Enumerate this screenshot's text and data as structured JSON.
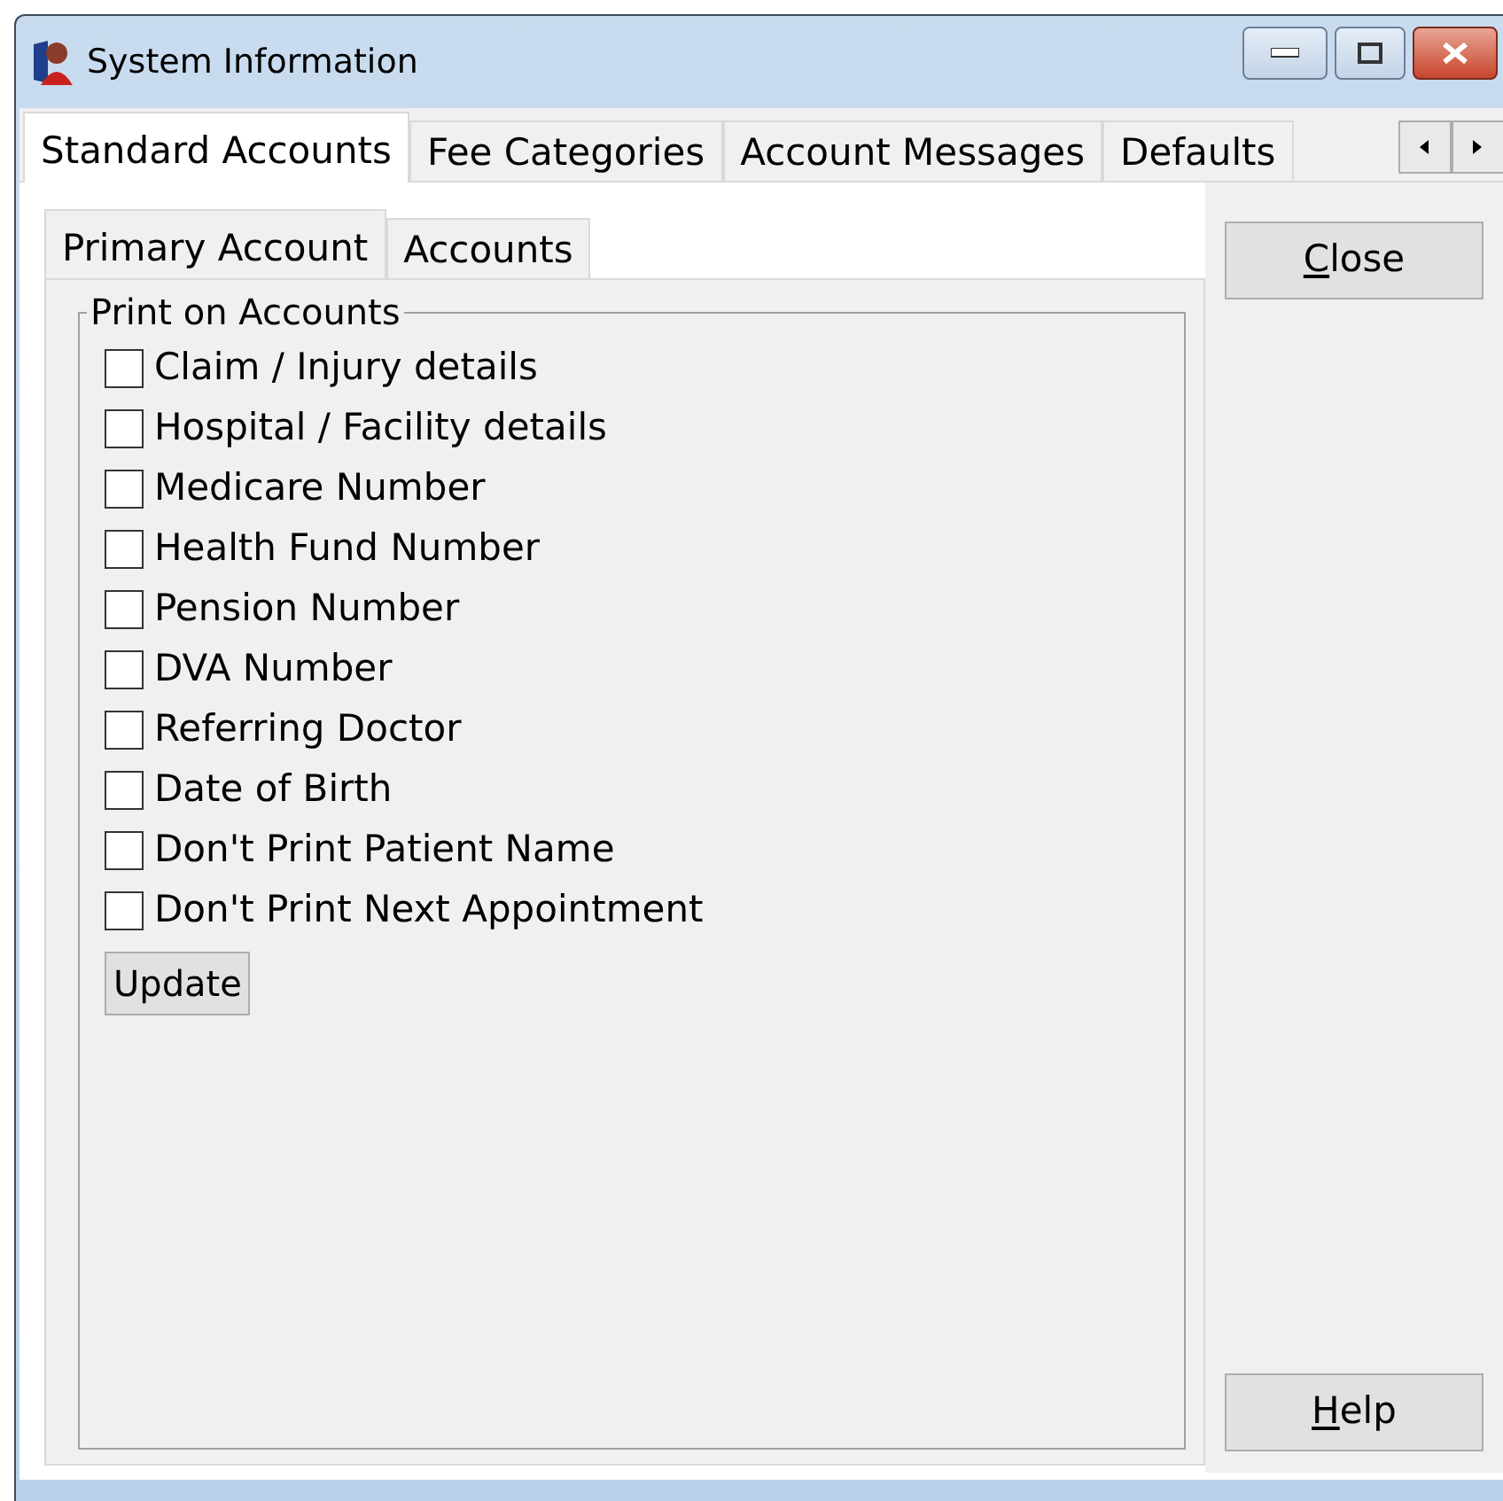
{
  "window": {
    "title": "System Information"
  },
  "tabs": [
    {
      "label": "Standard Accounts",
      "selected": true
    },
    {
      "label": "Fee Categories",
      "selected": false
    },
    {
      "label": "Account Messages",
      "selected": false
    },
    {
      "label": "Defaults",
      "selected": false
    }
  ],
  "sub_tabs": [
    {
      "label": "Primary Account",
      "selected": true
    },
    {
      "label": "Accounts",
      "selected": false
    }
  ],
  "group": {
    "title": "Print on Accounts",
    "options": [
      {
        "label": "Claim / Injury details",
        "checked": false
      },
      {
        "label": "Hospital / Facility details",
        "checked": false
      },
      {
        "label": "Medicare Number",
        "checked": false
      },
      {
        "label": "Health Fund Number",
        "checked": false
      },
      {
        "label": "Pension Number",
        "checked": false
      },
      {
        "label": "DVA Number",
        "checked": false
      },
      {
        "label": "Referring Doctor",
        "checked": false
      },
      {
        "label": "Date of Birth",
        "checked": false
      },
      {
        "label": "Don't Print Patient Name",
        "checked": false
      },
      {
        "label": "Don't Print Next Appointment",
        "checked": false
      }
    ],
    "button": "Update"
  },
  "side_buttons": [
    {
      "label": "Close",
      "mnemonic": true
    },
    {
      "label": "Help",
      "mnemonic": true
    }
  ]
}
